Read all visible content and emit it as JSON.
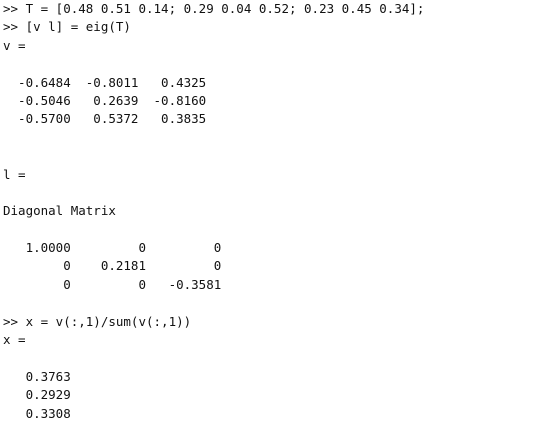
{
  "console": {
    "lines": [
      ">> T = [0.48 0.51 0.14; 0.29 0.04 0.52; 0.23 0.45 0.34];",
      ">> [v l] = eig(T)",
      "v =",
      "",
      "  -0.6484  -0.8011   0.4325",
      "  -0.5046   0.2639  -0.8160",
      "  -0.5700   0.5372   0.3835",
      "",
      "",
      "l =",
      "",
      "Diagonal Matrix",
      "",
      "   1.0000         0         0",
      "        0    0.2181         0",
      "        0         0   -0.3581",
      "",
      ">> x = v(:,1)/sum(v(:,1))",
      "x =",
      "",
      "   0.3763",
      "   0.2929",
      "   0.3308"
    ]
  }
}
